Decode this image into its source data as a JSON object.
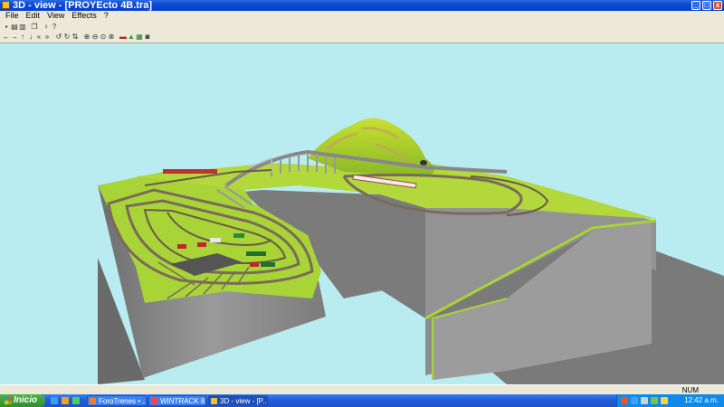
{
  "window": {
    "title": "3D - view - [PROYEcto 4B.tra]"
  },
  "menu": [
    "File",
    "Edit",
    "View",
    "Effects",
    "?"
  ],
  "toolbar": {
    "row1": [
      "save-icon",
      "print-icon",
      "print-preview-icon",
      "sep",
      "copy-icon",
      "sep",
      "pin-icon",
      "help-icon"
    ],
    "row2": [
      "arrow-left-icon",
      "arrow-right-icon",
      "arrow-up-icon",
      "arrow-down-icon",
      "arrow-double-left-icon",
      "arrow-double-right-icon",
      "sep",
      "rotate-left-icon",
      "rotate-right-icon",
      "tilt-icon",
      "sep",
      "zoom-in-icon",
      "zoom-out-icon",
      "zoom-fit-icon",
      "zoom-region-icon",
      "sep",
      "train-icon",
      "landscape-icon",
      "grid-icon",
      "camera-icon"
    ]
  },
  "statusbar": {
    "num": "NUM"
  },
  "taskbar": {
    "start_label": "Inicio",
    "tasks": [
      {
        "label": "ForoTrenes • ...",
        "icon_color": "#f08020",
        "active": false
      },
      {
        "label": "WINTRACK 8....",
        "icon_color": "#ff4040",
        "active": false
      },
      {
        "label": "3D - view - [P...",
        "icon_color": "#f0c030",
        "active": true
      }
    ],
    "clock": "12:42 a.m."
  },
  "colors": {
    "sky": "#b8ecf0",
    "grass": "#a8d438",
    "cliff": "#8a8a8a",
    "rail": "#7a6a5a",
    "titlebar": "#0a46d6"
  }
}
